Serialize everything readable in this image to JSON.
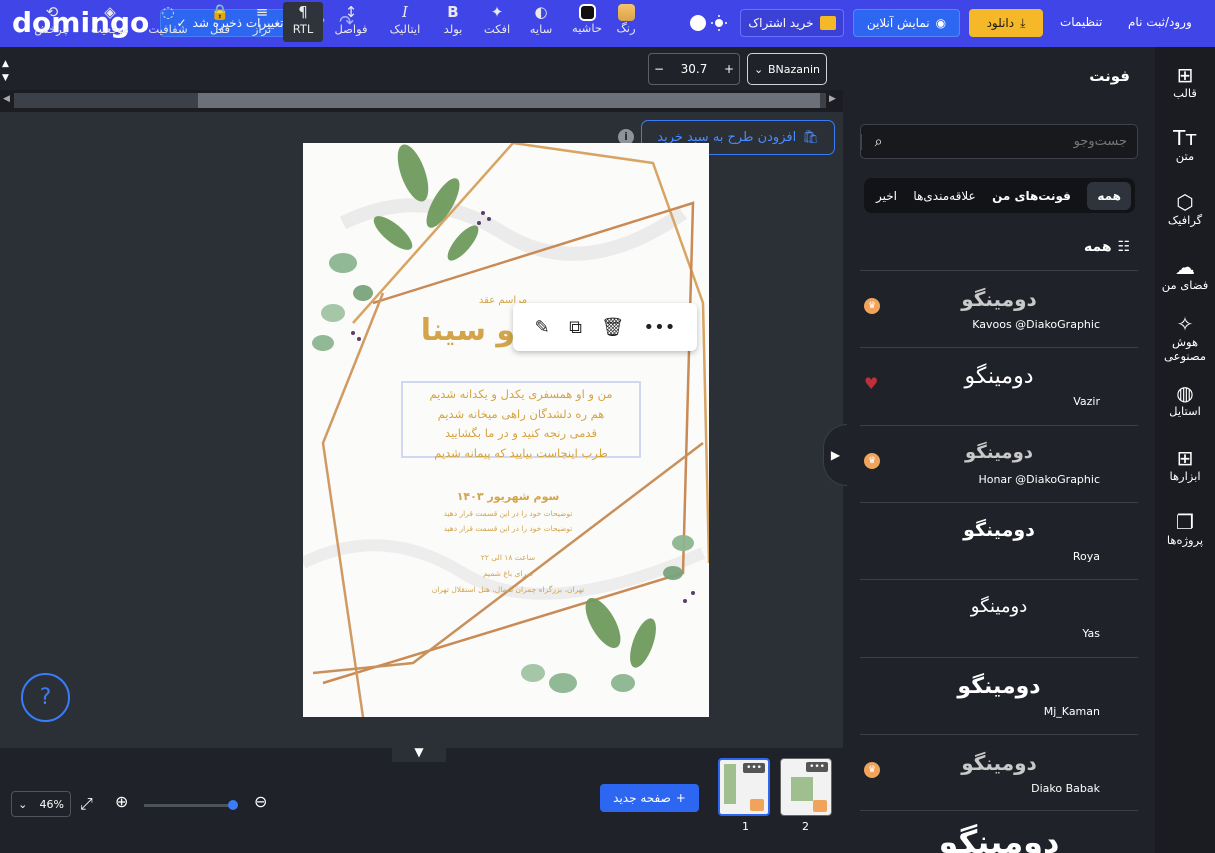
{
  "app": {
    "logo": "domingo",
    "save_status": "تغییرات ذخیره شد"
  },
  "topbar": {
    "subscribe": "خرید اشتراک",
    "preview": "نمایش آنلاین",
    "download": "دانلود",
    "settings": "تنظیمات",
    "login": "ورود/ثبت نام"
  },
  "toolbar": {
    "tools": [
      {
        "label": "چرخش",
        "icon": "rotate-icon",
        "glyph": "⟲"
      },
      {
        "label": "موقعیت",
        "icon": "layers-icon",
        "glyph": "◈"
      },
      {
        "label": "شفافیت",
        "icon": "opacity-icon",
        "glyph": "◌"
      },
      {
        "label": "قفل",
        "icon": "lock-icon",
        "glyph": "🔒"
      },
      {
        "label": "تراز",
        "icon": "align-icon",
        "glyph": "≡"
      },
      {
        "label": "RTL",
        "icon": "rtl-icon",
        "glyph": "¶"
      },
      {
        "label": "فواصل",
        "icon": "spacing-icon",
        "glyph": "↕"
      },
      {
        "label": "ایتالیک",
        "icon": "italic-icon",
        "glyph": "I"
      },
      {
        "label": "بولد",
        "icon": "bold-icon",
        "glyph": "B"
      },
      {
        "label": "افکت",
        "icon": "effect-icon",
        "glyph": "✦"
      },
      {
        "label": "سایه",
        "icon": "shadow-icon",
        "glyph": "◐"
      },
      {
        "label": "حاشیه",
        "icon": "border-icon",
        "glyph": "▢"
      },
      {
        "label": "رنگ",
        "icon": "color-icon",
        "glyph": "■"
      }
    ],
    "font_size": "30.7",
    "font_family": "BNazanin"
  },
  "canvas": {
    "add_to_cart": "افزودن طرح به سبد خرید",
    "invitation": {
      "line_small": "مراسم عقد",
      "names": "امیر و سینا",
      "verse": [
        "من و او همسفری یکدل و یکدانه شدیم",
        "هم ره دلشدگان راهی میخانه شدیم",
        "قدمی رنجه کنید و در ما بگشایید",
        "طرب اینجاست بیایید که پیمانه شدیم"
      ],
      "date": "سوم شهریور ۱۴۰۳",
      "sub1": "توضیحات خود را در این قسمت قرار دهید",
      "sub2": "توضیحات خود را در این قسمت قرار دهید",
      "time": "ساعت ۱۸ الی ۲۲",
      "note": "سرای باغ شمیم",
      "address": "تهران، بزرگراه چمران شمال، هتل استقلال تهران"
    }
  },
  "bottom": {
    "zoom": "46%",
    "new_page": "صفحه جدید",
    "pages": [
      "1",
      "2"
    ]
  },
  "font_panel": {
    "title": "فونت",
    "search_placeholder": "جست‌وجو",
    "tabs": [
      "اخیر",
      "علاقه‌مندی‌ها",
      "فونت‌های من",
      "همه"
    ],
    "section": "همه",
    "sample": "دومینگو",
    "fonts": [
      {
        "name": "Kavoos @DiakoGraphic",
        "badge": "premium"
      },
      {
        "name": "Vazir",
        "badge": "heart"
      },
      {
        "name": "Honar @DiakoGraphic",
        "badge": "premium"
      },
      {
        "name": "Roya",
        "badge": ""
      },
      {
        "name": "Yas",
        "badge": ""
      },
      {
        "name": "Mj_Kaman",
        "badge": ""
      },
      {
        "name": "Diako Babak",
        "badge": "premium"
      }
    ]
  },
  "sidebar": {
    "items": [
      {
        "label": "قالب",
        "icon": "template-icon",
        "glyph": "⊞"
      },
      {
        "label": "متن",
        "icon": "text-icon",
        "glyph": "Tт"
      },
      {
        "label": "گرافیک",
        "icon": "graphic-icon",
        "glyph": "⬡"
      },
      {
        "label": "فضای من",
        "icon": "cloud-upload-icon",
        "glyph": "☁"
      },
      {
        "label": "هوش مصنوعی",
        "icon": "magic-icon",
        "glyph": "✧"
      },
      {
        "label": "استایل",
        "icon": "palette-icon",
        "glyph": "◍"
      },
      {
        "label": "ابزارها",
        "icon": "tools-icon",
        "glyph": "⊞"
      },
      {
        "label": "پروژه‌ها",
        "icon": "projects-icon",
        "glyph": "❐"
      }
    ]
  },
  "colors": {
    "brand": "#3f45e6",
    "accent": "#2d66f0",
    "gold": "#d3a44a",
    "download": "#f5b829"
  }
}
